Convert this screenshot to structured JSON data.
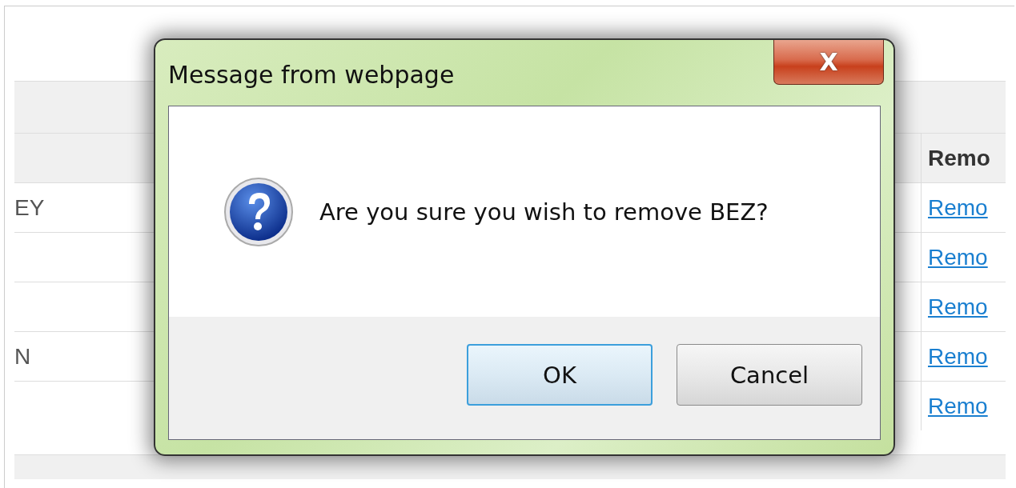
{
  "table": {
    "header": {
      "remove": "Remo"
    },
    "rows": [
      {
        "column_1": "EY",
        "remove": "Remo"
      },
      {
        "remove": "Remo"
      },
      {
        "remove": "Remo"
      },
      {
        "column_1": "N",
        "remove": "Remo"
      },
      {
        "remove": "Remo"
      }
    ]
  },
  "dialog": {
    "title": "Message from webpage",
    "close": "X",
    "message": "Are you sure you wish to remove BEZ?",
    "buttons": [
      {
        "label": "OK",
        "selected": true
      },
      {
        "label": "Cancel",
        "selected": false
      }
    ]
  }
}
